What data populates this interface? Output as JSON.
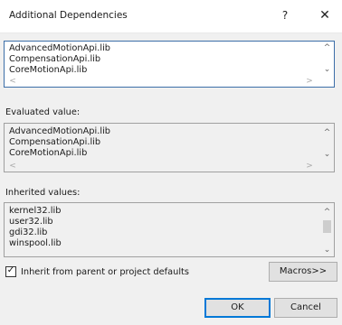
{
  "window": {
    "title": "Additional Dependencies",
    "help": "?",
    "close": "✕"
  },
  "edit": {
    "lines": [
      "AdvancedMotionApi.lib",
      "CompensationApi.lib",
      "CoreMotionApi.lib"
    ]
  },
  "evaluated": {
    "label": "Evaluated value:",
    "lines": [
      "AdvancedMotionApi.lib",
      "CompensationApi.lib",
      "CoreMotionApi.lib"
    ]
  },
  "inherited": {
    "label": "Inherited values:",
    "lines": [
      "kernel32.lib",
      "user32.lib",
      "gdi32.lib",
      "winspool.lib"
    ]
  },
  "inherit_checkbox": {
    "label": "Inherit from parent or project defaults",
    "checked": true,
    "mark": "✓"
  },
  "buttons": {
    "macros": "Macros>>",
    "ok": "OK",
    "cancel": "Cancel"
  },
  "icons": {
    "up": "^",
    "down": "⌄",
    "left": "<",
    "right": ">"
  }
}
